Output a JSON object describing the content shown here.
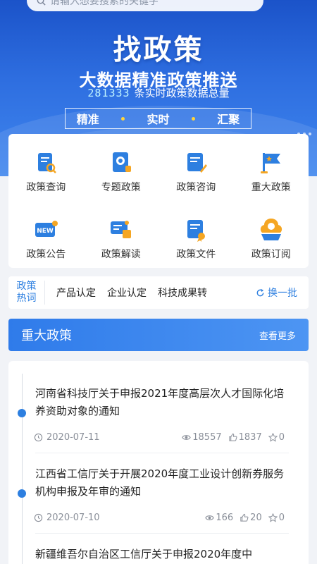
{
  "banner": {
    "search_placeholder": "请输入想要搜索的关键字",
    "title": "找政策",
    "subtitle": "大数据精准政策推送",
    "stats_number": "281333",
    "stats_text": "条实时政策数据总量",
    "tags": [
      "精准",
      "实时",
      "汇聚"
    ]
  },
  "menu": {
    "items": [
      {
        "label": "政策查询",
        "icon": "policy-search-icon"
      },
      {
        "label": "专题政策",
        "icon": "topic-policy-icon"
      },
      {
        "label": "政策咨询",
        "icon": "policy-consult-icon"
      },
      {
        "label": "重大政策",
        "icon": "major-policy-icon"
      },
      {
        "label": "政策公告",
        "icon": "announcement-new-icon"
      },
      {
        "label": "政策解读",
        "icon": "policy-interpret-icon"
      },
      {
        "label": "政策文件",
        "icon": "policy-file-icon"
      },
      {
        "label": "政策订阅",
        "icon": "subscribe-icon"
      }
    ]
  },
  "hot": {
    "label_line1": "政策",
    "label_line2": "热词",
    "items": [
      "产品认定",
      "企业认定",
      "科技成果转"
    ],
    "refresh": "换一批"
  },
  "section": {
    "title": "重大政策",
    "more": "查看更多"
  },
  "news": [
    {
      "title": "河南省科技厅关于申报2021年度高层次人才国际化培养资助对象的通知",
      "date": "2020-07-11",
      "views": "18557",
      "likes": "1837",
      "stars": "0"
    },
    {
      "title": "江西省工信厅关于开展2020年度工业设计创新券服务机构申报及年审的通知",
      "date": "2020-07-10",
      "views": "166",
      "likes": "20",
      "stars": "0"
    },
    {
      "title": "新疆维吾尔自治区工信厅关于申报2020年度中",
      "date": "",
      "views": "",
      "likes": "",
      "stars": ""
    }
  ],
  "colors": {
    "accent": "#2d7fe0",
    "banner_top": "#1b53c9",
    "banner_bottom": "#3f86ee",
    "tag_dot": "#ffd43b",
    "stats_number": "#bff3ff"
  }
}
